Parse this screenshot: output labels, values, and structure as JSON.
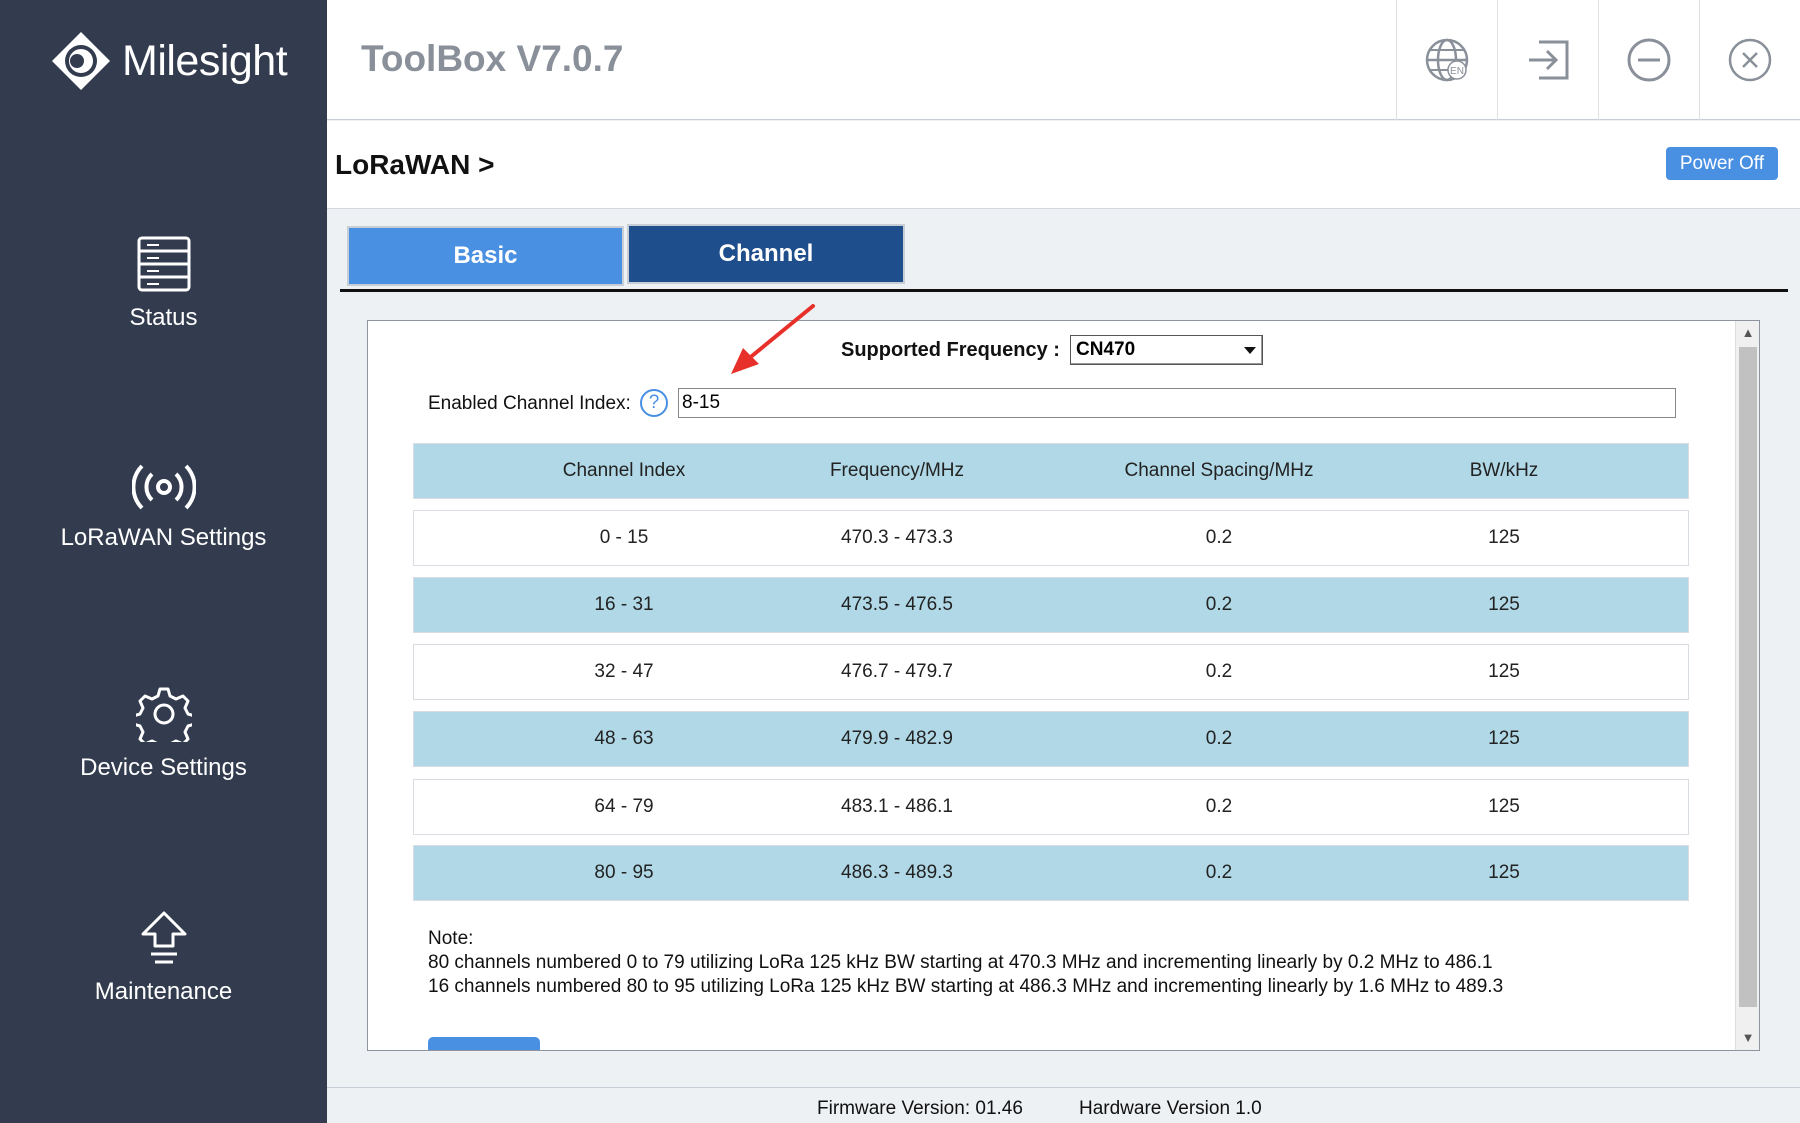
{
  "sidebar": {
    "brand": "Milesight",
    "items": [
      {
        "label": "Status",
        "icon": "server-list-icon"
      },
      {
        "label": "LoRaWAN Settings",
        "icon": "wireless-signal-icon"
      },
      {
        "label": "Device Settings",
        "icon": "gear-icon"
      },
      {
        "label": "Maintenance",
        "icon": "upload-arrow-icon"
      }
    ]
  },
  "header": {
    "title": "ToolBox V7.0.7",
    "language_badge": "EN"
  },
  "subheader": {
    "breadcrumb": "LoRaWAN >",
    "power_button": "Power Off"
  },
  "tabs": [
    {
      "label": "Basic",
      "active": false
    },
    {
      "label": "Channel",
      "active": true
    }
  ],
  "form": {
    "frequency_label": "Supported Frequency :",
    "frequency_value": "CN470",
    "channel_index_label": "Enabled Channel Index:",
    "channel_index_value": "8-15",
    "help_glyph": "?"
  },
  "table": {
    "headers": [
      "Channel Index",
      "Frequency/MHz",
      "Channel Spacing/MHz",
      "BW/kHz"
    ],
    "rows": [
      [
        "0 - 15",
        "470.3 - 473.3",
        "0.2",
        "125"
      ],
      [
        "16 - 31",
        "473.5 - 476.5",
        "0.2",
        "125"
      ],
      [
        "32 - 47",
        "476.7 - 479.7",
        "0.2",
        "125"
      ],
      [
        "48 - 63",
        "479.9 - 482.9",
        "0.2",
        "125"
      ],
      [
        "64 - 79",
        "483.1 - 486.1",
        "0.2",
        "125"
      ],
      [
        "80 - 95",
        "486.3 - 489.3",
        "0.2",
        "125"
      ]
    ]
  },
  "note": {
    "title": "Note:",
    "lines": [
      "80 channels numbered 0 to 79 utilizing LoRa 125 kHz BW starting at 470.3 MHz and incrementing linearly by 0.2 MHz to 486.1",
      "16 channels numbered 80 to 95 utilizing LoRa 125 kHz BW starting at 486.3 MHz and incrementing linearly by 1.6 MHz to 489.3"
    ]
  },
  "footer": {
    "firmware": "Firmware Version:  01.46",
    "hardware": "Hardware Version  1.0"
  },
  "colors": {
    "sidebar_bg": "#333c4f",
    "tab_basic": "#4a90e2",
    "tab_channel": "#1f4e8c",
    "row_blue": "#b0d8e6",
    "annotation_arrow": "#e8302a"
  }
}
